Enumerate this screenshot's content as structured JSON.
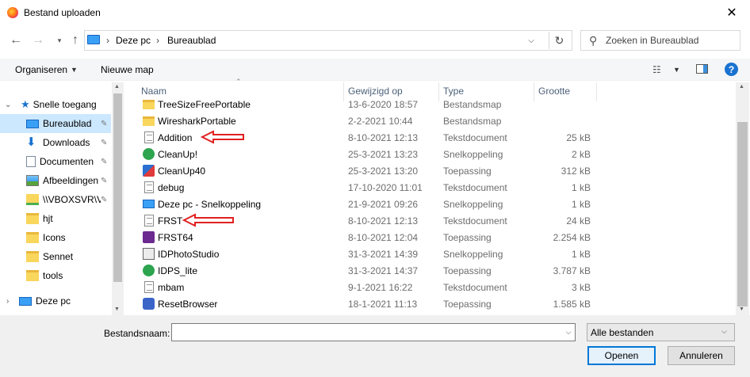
{
  "window": {
    "title": "Bestand uploaden"
  },
  "address": {
    "crumbs": [
      "Deze pc",
      "Bureaublad"
    ],
    "sep": "›"
  },
  "search": {
    "placeholder": "Zoeken in Bureaublad"
  },
  "toolbar": {
    "organise": "Organiseren",
    "new_folder": "Nieuwe map"
  },
  "sidebar": {
    "items": [
      {
        "label": "Snelle toegang",
        "icon": "star-icon"
      },
      {
        "label": "Bureaublad",
        "icon": "desktop-icon",
        "pinned": true
      },
      {
        "label": "Downloads",
        "icon": "download-icon",
        "pinned": true
      },
      {
        "label": "Documenten",
        "icon": "document-icon",
        "pinned": true
      },
      {
        "label": "Afbeeldingen",
        "icon": "pictures-icon",
        "pinned": true
      },
      {
        "label": "\\\\VBOXSVR\\V",
        "icon": "network-drive-icon",
        "pinned": true
      },
      {
        "label": "hjt",
        "icon": "folder-icon"
      },
      {
        "label": "Icons",
        "icon": "folder-icon"
      },
      {
        "label": "Sennet",
        "icon": "folder-icon"
      },
      {
        "label": "tools",
        "icon": "folder-icon"
      },
      {
        "label": "Deze pc",
        "icon": "pc-icon"
      }
    ]
  },
  "columns": {
    "name": "Naam",
    "modified": "Gewijzigd op",
    "type": "Type",
    "size": "Grootte"
  },
  "files": [
    {
      "name": "TreeSizeFreePortable",
      "date": "13-6-2020 18:57",
      "type": "Bestandsmap",
      "size": "",
      "icon": "folder"
    },
    {
      "name": "WiresharkPortable",
      "date": "2-2-2021 10:44",
      "type": "Bestandsmap",
      "size": "",
      "icon": "folder"
    },
    {
      "name": "Addition",
      "date": "8-10-2021 12:13",
      "type": "Tekstdocument",
      "size": "25 kB",
      "icon": "txt"
    },
    {
      "name": "CleanUp!",
      "date": "25-3-2021 13:23",
      "type": "Snelkoppeling",
      "size": "2 kB",
      "icon": "green"
    },
    {
      "name": "CleanUp40",
      "date": "25-3-2021 13:20",
      "type": "Toepassing",
      "size": "312 kB",
      "icon": "app"
    },
    {
      "name": "debug",
      "date": "17-10-2020 11:01",
      "type": "Tekstdocument",
      "size": "1 kB",
      "icon": "txt"
    },
    {
      "name": "Deze pc - Snelkoppeling",
      "date": "21-9-2021 09:26",
      "type": "Snelkoppeling",
      "size": "1 kB",
      "icon": "pc"
    },
    {
      "name": "FRST",
      "date": "8-10-2021 12:13",
      "type": "Tekstdocument",
      "size": "24 kB",
      "icon": "txt"
    },
    {
      "name": "FRST64",
      "date": "8-10-2021 12:04",
      "type": "Toepassing",
      "size": "2.254 kB",
      "icon": "frst"
    },
    {
      "name": "IDPhotoStudio",
      "date": "31-3-2021 14:39",
      "type": "Snelkoppeling",
      "size": "1 kB",
      "icon": "id"
    },
    {
      "name": "IDPS_lite",
      "date": "31-3-2021 14:37",
      "type": "Toepassing",
      "size": "3.787 kB",
      "icon": "green"
    },
    {
      "name": "mbam",
      "date": "9-1-2021 16:22",
      "type": "Tekstdocument",
      "size": "3 kB",
      "icon": "txt"
    },
    {
      "name": "ResetBrowser",
      "date": "18-1-2021 11:13",
      "type": "Toepassing",
      "size": "1.585 kB",
      "icon": "reset"
    }
  ],
  "footer": {
    "filename_label": "Bestandsnaam:",
    "filename_value": "",
    "filetype": "Alle bestanden",
    "open": "Openen",
    "cancel": "Annuleren"
  },
  "colors": {
    "selection": "#cce8ff",
    "accent": "#0078d7",
    "annotation": "#e02020"
  }
}
